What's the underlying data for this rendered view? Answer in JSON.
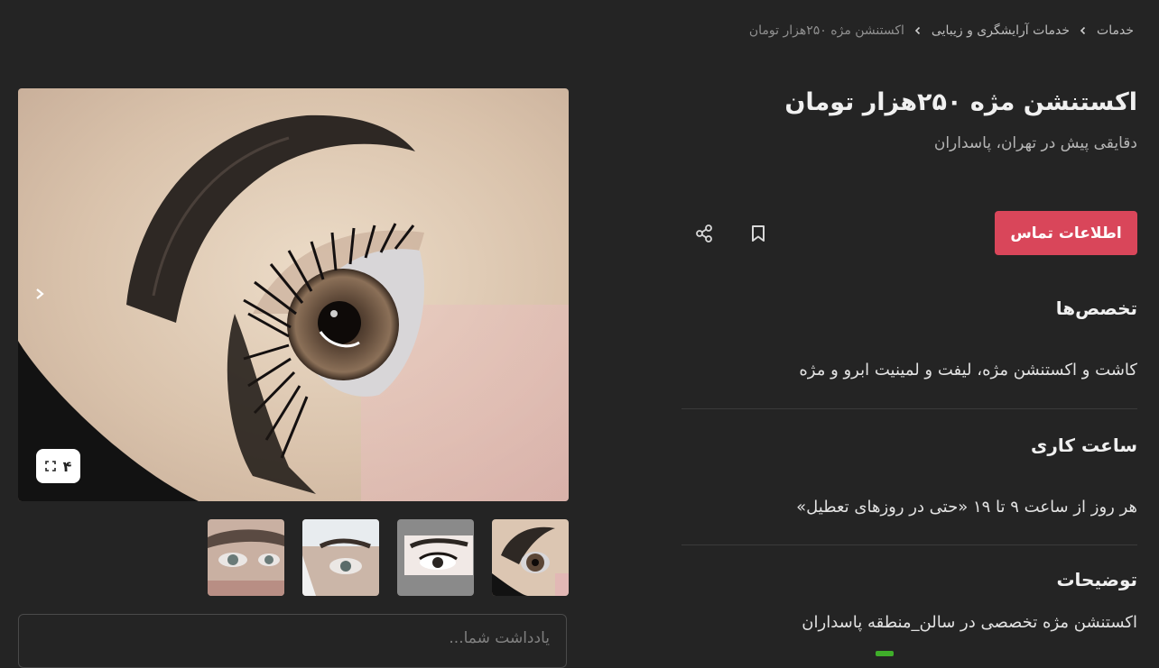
{
  "breadcrumb": {
    "items": [
      "خدمات",
      "خدمات آرایشگری و زیبایی",
      "اکستنشن مژه ۲۵۰هزار تومان"
    ]
  },
  "listing": {
    "title": "اکستنشن مژه ۲۵۰هزار تومان",
    "subtitle": "دقایقی پیش در تهران، پاسداران",
    "contact_button": "اطلاعات تماس"
  },
  "sections": {
    "specialties": {
      "heading": "تخصص‌ها",
      "body": "کاشت و اکستنشن مژه، لیفت و لمینیت ابرو و مژه"
    },
    "hours": {
      "heading": "ساعت کاری",
      "body": "هر روز از ساعت ۹ تا ۱۹ «حتی در روزهای تعطیل»"
    },
    "description": {
      "heading": "توضیحات",
      "body": "اکستنشن مژه تخصصی در سالن_منطقه پاسداران"
    }
  },
  "gallery": {
    "image_count": "۴",
    "main_image_icon": "eye-lash-photo",
    "thumbnail_count": 4
  },
  "note": {
    "placeholder": "یادداشت شما..."
  },
  "colors": {
    "background": "#242424",
    "accent": "#d9465a",
    "text": "#e6e6e6",
    "muted": "#b5b5b5"
  },
  "icons": {
    "share": "share-icon",
    "bookmark": "bookmark-icon",
    "next": "chevron-right-icon",
    "expand": "expand-icon",
    "breadcrumb_sep": "chevron-left-icon"
  }
}
